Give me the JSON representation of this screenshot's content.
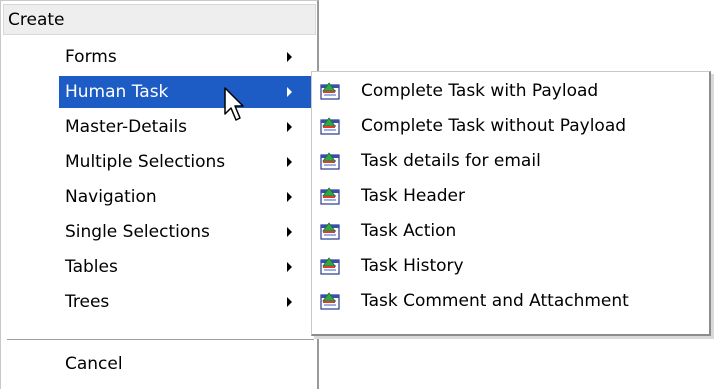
{
  "main_menu": {
    "header": "Create",
    "items": [
      {
        "label": "Forms"
      },
      {
        "label": "Human Task"
      },
      {
        "label": "Master-Details"
      },
      {
        "label": "Multiple Selections"
      },
      {
        "label": "Navigation"
      },
      {
        "label": "Single Selections"
      },
      {
        "label": "Tables"
      },
      {
        "label": "Trees"
      }
    ],
    "cancel_label": "Cancel",
    "selected_item": "Human Task"
  },
  "submenu": {
    "items": [
      {
        "label": "Complete Task with Payload",
        "icon": "task-form-icon"
      },
      {
        "label": "Complete Task without Payload",
        "icon": "task-form-icon"
      },
      {
        "label": "Task details for email",
        "icon": "task-form-icon"
      },
      {
        "label": "Task Header",
        "icon": "task-form-icon"
      },
      {
        "label": "Task Action",
        "icon": "task-form-icon"
      },
      {
        "label": "Task History",
        "icon": "task-form-icon"
      },
      {
        "label": "Task Comment and Attachment",
        "icon": "task-form-icon"
      }
    ]
  },
  "colors": {
    "highlight": "#1d5cc4",
    "header_background": "#eeeeee",
    "border_dark": "#8c8c8c"
  }
}
